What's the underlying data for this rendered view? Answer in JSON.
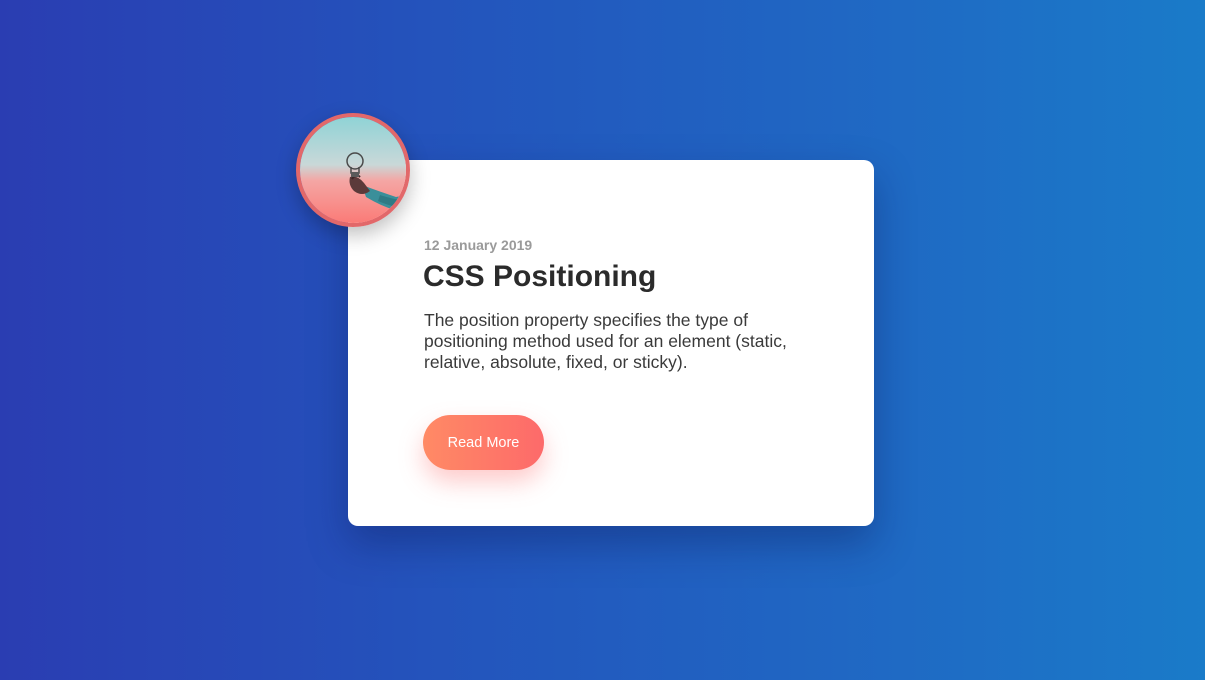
{
  "card": {
    "date": "12 January 2019",
    "title": "CSS Positioning",
    "description": "The position property specifies the type of positioning method used for an element (static, relative, absolute, fixed, or sticky).",
    "button_label": "Read More"
  },
  "avatar": {
    "icon": "lightbulb-in-hand-photo"
  },
  "colors": {
    "background_start": "#2a3db2",
    "background_end": "#1a7bc9",
    "button_start": "#ff8a65",
    "button_end": "#fd6a6a",
    "avatar_border": "#e2686a"
  }
}
